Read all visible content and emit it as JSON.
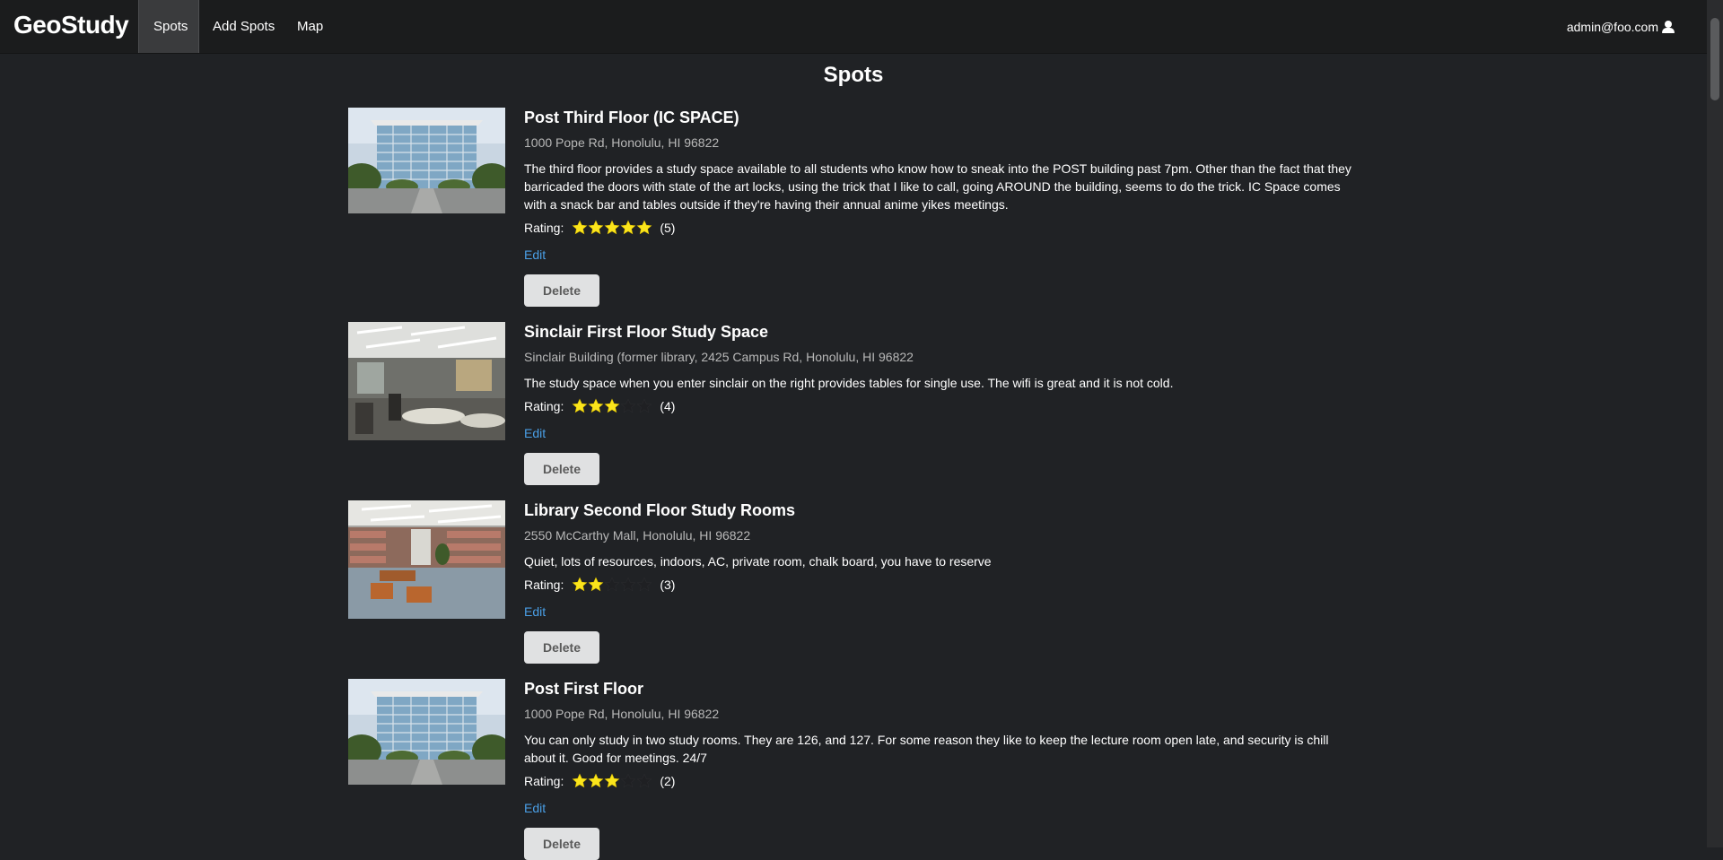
{
  "nav": {
    "brand": "GeoStudy",
    "items": [
      {
        "label": "Spots",
        "active": true
      },
      {
        "label": "Add Spots",
        "active": false
      },
      {
        "label": "Map",
        "active": false
      }
    ],
    "user": "admin@foo.com",
    "user_icon": "user-icon"
  },
  "page": {
    "title": "Spots"
  },
  "labels": {
    "rating": "Rating:",
    "edit": "Edit",
    "delete": "Delete"
  },
  "spots": [
    {
      "title": "Post Third Floor (IC SPACE)",
      "address": "1000 Pope Rd, Honolulu, HI 96822",
      "description": "The third floor provides a study space available to all students who know how to sneak into the POST building past 7pm. Other than the fact that they barricaded the doors with state of the art locks, using the trick that I like to call, going AROUND the building, seems to do the trick. IC Space comes with a snack bar and tables outside if they're having their annual anime yikes meetings.",
      "stars": 5,
      "rating_count": "(5)",
      "image": "building-exterior"
    },
    {
      "title": "Sinclair First Floor Study Space",
      "address": "Sinclair Building (former library, 2425 Campus Rd, Honolulu, HI 96822",
      "description": "The study space when you enter sinclair on the right provides tables for single use. The wifi is great and it is not cold.",
      "stars": 3,
      "rating_count": "(4)",
      "image": "study-hall-interior"
    },
    {
      "title": "Library Second Floor Study Rooms",
      "address": "2550 McCarthy Mall, Honolulu, HI 96822",
      "description": "Quiet, lots of resources, indoors, AC, private room, chalk board, you have to reserve",
      "stars": 2,
      "rating_count": "(3)",
      "image": "library-interior"
    },
    {
      "title": "Post First Floor",
      "address": "1000 Pope Rd, Honolulu, HI 96822",
      "description": "You can only study in two study rooms. They are 126, and 127. For some reason they like to keep the lecture room open late, and security is chill about it. Good for meetings. 24/7",
      "stars": 3,
      "rating_count": "(2)",
      "image": "building-exterior"
    }
  ],
  "colors": {
    "background": "#202225",
    "navbar": "#1b1c1d",
    "star_filled": "#fbe51c",
    "link": "#4a9fe6"
  }
}
